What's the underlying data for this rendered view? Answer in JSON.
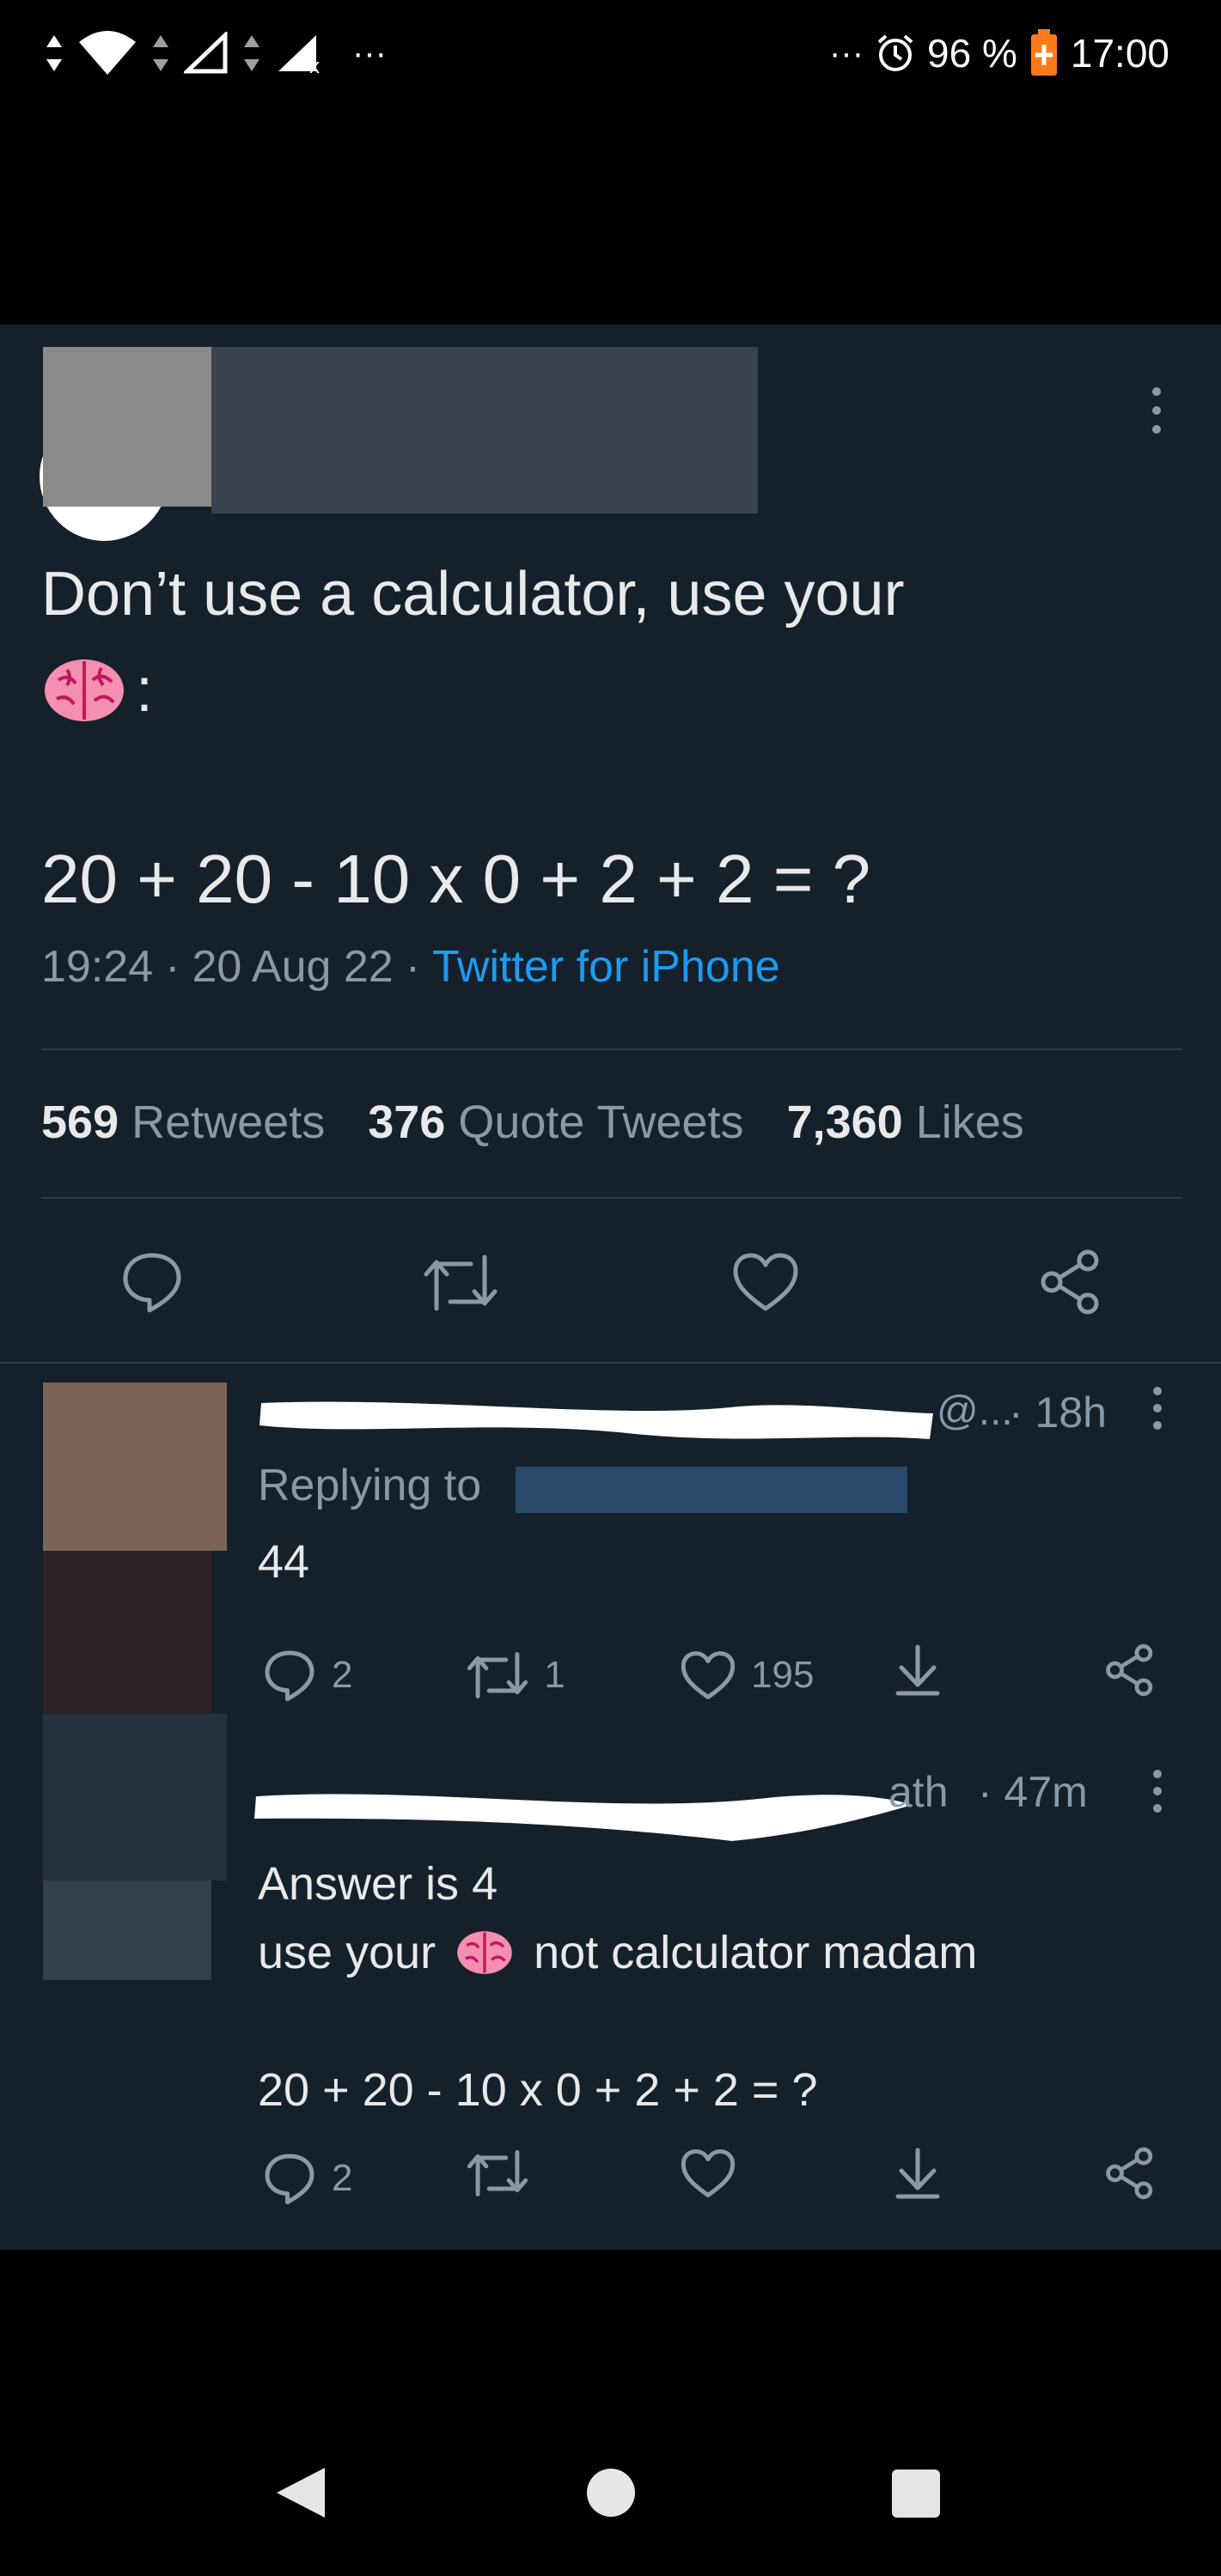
{
  "status_bar": {
    "battery_percent": "96 %",
    "time": "17:00",
    "more_dots": "···"
  },
  "tweet": {
    "text_line1": "Don’t use a calculator, use your",
    "text_line2_suffix": ":",
    "equation": "20 + 20 - 10 x 0 + 2 + 2 = ?",
    "time": "19:24",
    "sep1": "·",
    "date": "20 Aug 22",
    "sep2": "·",
    "source": "Twitter for iPhone",
    "stats": {
      "retweets_count": "569",
      "retweets_label": "Retweets",
      "quotes_count": "376",
      "quotes_label": "Quote Tweets",
      "likes_count": "7,360",
      "likes_label": "Likes"
    }
  },
  "replies": [
    {
      "handle_tail": "@...",
      "time": "· 18h",
      "replying_to": "Replying to",
      "text_lines": [
        "44"
      ],
      "counts": {
        "replies": "2",
        "retweets": "1",
        "likes": "195"
      }
    },
    {
      "name_tail": "ath",
      "time": "· 47m",
      "text_lines": [
        "Answer is 4",
        "not calculator madam",
        "20 + 20 - 10 x 0 + 2 + 2 = ?"
      ],
      "use_your": "use your",
      "counts": {
        "replies": "2"
      }
    }
  ],
  "colors": {
    "background": "#15202b",
    "accent": "#1d9bf0",
    "muted": "#8b98a5"
  },
  "icons": [
    "wifi-icon",
    "signal-icon",
    "alarm-icon",
    "battery-icon",
    "more-vert-icon",
    "brain-emoji",
    "reply-icon",
    "retweet-icon",
    "like-icon",
    "share-icon",
    "bookmark-icon",
    "back-icon",
    "home-icon",
    "recents-icon"
  ]
}
